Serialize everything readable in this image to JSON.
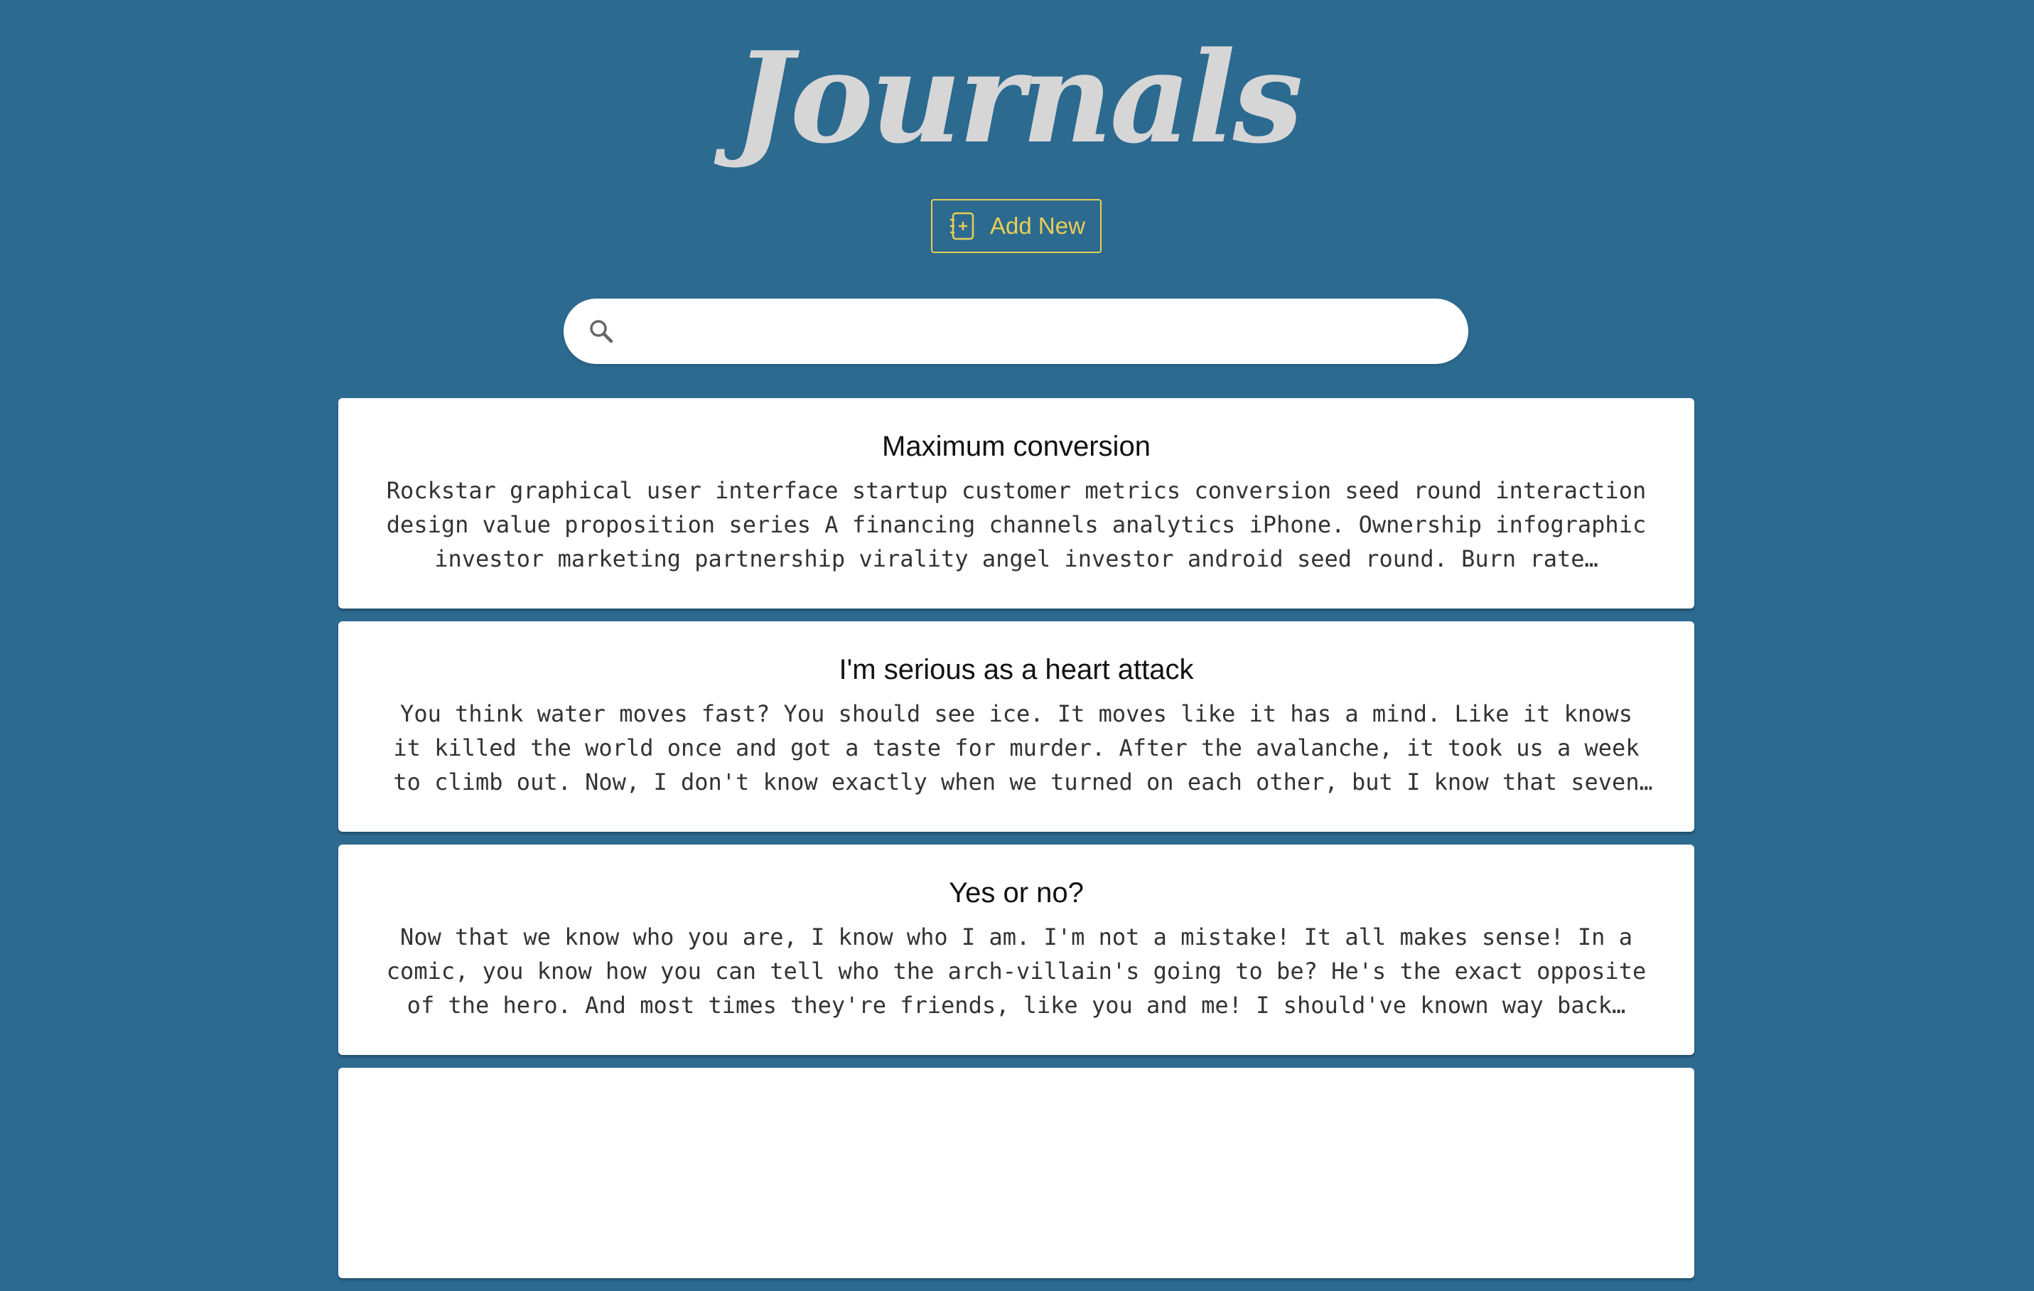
{
  "header": {
    "title": "Journals",
    "add_button_label": "Add New",
    "add_button_icon": "add-journal-icon"
  },
  "search": {
    "placeholder": "",
    "value": "",
    "icon": "search-icon"
  },
  "colors": {
    "background": "#2c6a90",
    "title": "#d6d6d6",
    "accent": "#e8cf55",
    "card": "#ffffff"
  },
  "journals": [
    {
      "title": "Maximum conversion",
      "excerpt": "Rockstar graphical user interface startup customer metrics conversion seed round interaction design value proposition series A financing channels analytics iPhone. Ownership infographic investor marketing partnership virality angel investor android seed round. Burn rate…"
    },
    {
      "title": "I'm serious as a heart attack",
      "excerpt": "You think water moves fast? You should see ice. It moves like it has a mind. Like it knows it killed the world once and got a taste for murder. After the avalanche, it took us a week to climb out. Now, I don't know exactly when we turned on each other, but I know that seven of…"
    },
    {
      "title": "Yes or no?",
      "excerpt": "Now that we know who you are, I know who I am. I'm not a mistake! It all makes sense! In a comic, you know how you can tell who the arch-villain's going to be? He's the exact opposite of the hero. And most times they're friends, like you and me! I should've known way back…"
    }
  ]
}
